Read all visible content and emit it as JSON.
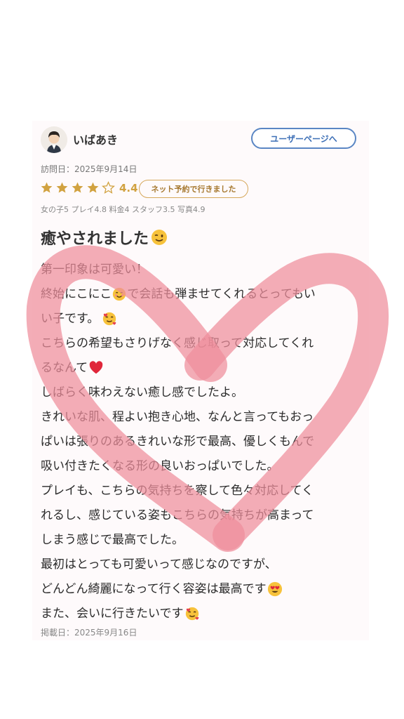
{
  "user": {
    "name": "いばあき",
    "profile_button": "ユーザーページへ"
  },
  "review": {
    "visit_date": "訪問日：2025年9月14日",
    "rating": 4.4,
    "rating_text": "4.4",
    "stars_filled": 4,
    "stars_total": 5,
    "reservation_badge": "ネット予約で行きました",
    "subscores": "女の子5 プレイ4.8 料金4 スタッフ3.5 写真4.9",
    "title": "癒やされました",
    "lines": [
      "第一印象は可愛い！",
      "終始にこにこ",
      "で会話も弾ませてくれるとってもい",
      "い子です。",
      "こちらの希望もさりげなく感じ取って対応してくれ",
      "るなんて",
      "しばらく味わえない癒し感でしたよ。",
      "きれいな肌、程よい抱き心地、なんと言ってもおっ",
      "ぱいは張りのあるきれいな形で最高、優しくもんで",
      "吸い付きたくなる形の良いおっぱいでした。",
      "プレイも、こちらの気持ちを察して色々対応してく",
      "れるし、感じている姿もこちらの気持ちが高まって",
      "しまう感じで最高でした。",
      "最初はとっても可愛いって感じなのですが、",
      "どんどん綺麗になって行く容姿は最高です",
      "また、会いに行きたいです"
    ],
    "posted_date": "掲載日：2025年9月16日"
  },
  "colors": {
    "profile_button": "#5a86c4",
    "star": "#d1a240",
    "badge": "#d6a85c",
    "heart_overlay": "#ef8d9b"
  }
}
